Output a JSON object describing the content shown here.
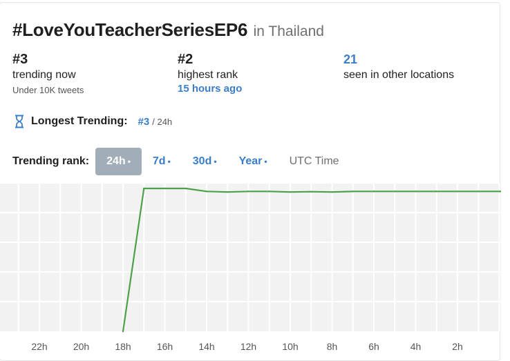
{
  "header": {
    "hashtag": "#LoveYouTeacherSeriesEP6",
    "location": "in Thailand"
  },
  "stats": {
    "current": {
      "rank": "#3",
      "label": "trending now",
      "sub": "Under 10K tweets"
    },
    "highest": {
      "rank": "#2",
      "label": "highest rank",
      "sub": "15 hours ago"
    },
    "locations": {
      "count": "21",
      "label": "seen in other locations"
    }
  },
  "longest": {
    "label": "Longest Trending:",
    "rank": "#3",
    "period": "/ 24h"
  },
  "trend_tabs": {
    "label": "Trending rank:",
    "items": [
      {
        "label": "24h",
        "dot": "•",
        "active": true
      },
      {
        "label": "7d",
        "dot": "•",
        "active": false
      },
      {
        "label": "30d",
        "dot": "•",
        "active": false
      },
      {
        "label": "Year",
        "dot": "•",
        "active": false
      }
    ],
    "utc": "UTC Time"
  },
  "colors": {
    "accent_blue": "#3a7dc9",
    "active_tab_bg": "#a2adba",
    "line_green": "#4aa14a",
    "chart_bg": "#f2f2f2"
  },
  "chart_data": {
    "type": "line",
    "x_tick_labels": [
      "22h",
      "20h",
      "18h",
      "16h",
      "14h",
      "12h",
      "10h",
      "8h",
      "6h",
      "4h",
      "2h"
    ],
    "x_hours_ago": [
      24,
      23,
      22,
      21,
      20,
      19,
      18,
      17,
      16,
      15,
      14,
      13,
      12,
      11,
      10,
      9,
      8,
      7,
      6,
      5,
      4,
      3,
      2,
      1,
      0
    ],
    "series": [
      {
        "values": [
          null,
          null,
          null,
          null,
          null,
          null,
          50,
          2,
          2,
          2,
          3,
          3.2,
          3,
          3,
          3.2,
          3.1,
          3.2,
          3,
          3,
          3,
          3,
          3,
          3,
          3,
          3
        ]
      }
    ],
    "y_range": [
      1,
      50
    ],
    "grid": true
  }
}
